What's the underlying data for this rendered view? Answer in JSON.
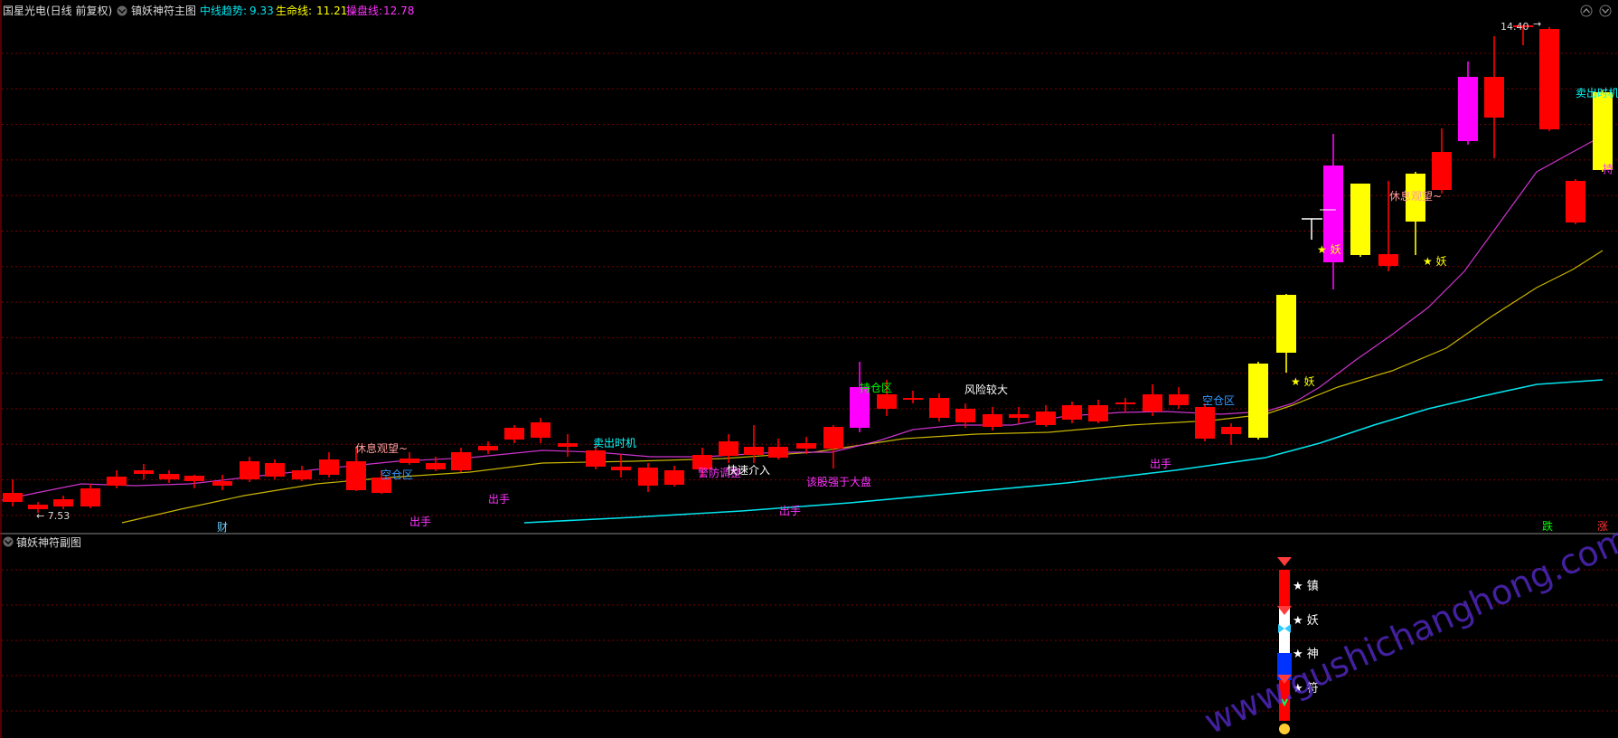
{
  "main_header": {
    "stock_name": "国星光电(日线 前复权)",
    "indicator_name": "镇妖神符主图",
    "midline_label": "中线趋势:",
    "midline_value": "9.33",
    "lifeline_label": "生命线:",
    "lifeline_value": "11.21",
    "operator_label": "操盘线:",
    "operator_value": "12.78"
  },
  "sub_header": {
    "indicator_name": "镇妖神符副图"
  },
  "price_marks": {
    "low_label": "← 7.53",
    "high_label": "14.40",
    "high_arrow": "→"
  },
  "annotations": [
    {
      "text": "休息观望~",
      "color": "#ff9b9b"
    },
    {
      "text": "空仓区",
      "color": "#3399ff"
    },
    {
      "text": "出手",
      "color": "#ff33ff"
    },
    {
      "text": "出手",
      "color": "#ff33ff"
    },
    {
      "text": "卖出时机",
      "color": "#00ffff"
    },
    {
      "text": "警防调整",
      "color": "#ff33ff"
    },
    {
      "text": "快速介入",
      "color": "#ffffff"
    },
    {
      "text": "该股强于大盘",
      "color": "#ff33ff"
    },
    {
      "text": "出手",
      "color": "#ff33ff"
    },
    {
      "text": "持仓区",
      "color": "#00ff00"
    },
    {
      "text": "风险较大",
      "color": "#ffffff"
    },
    {
      "text": "空仓区",
      "color": "#3399ff"
    },
    {
      "text": "出手",
      "color": "#ff33ff"
    },
    {
      "text": "★ 妖",
      "color": "#ffff00"
    },
    {
      "text": "★ 妖",
      "color": "#ffff00"
    },
    {
      "text": "★ 妖",
      "color": "#ffff00"
    },
    {
      "text": "休息观望~",
      "color": "#ff9b9b"
    },
    {
      "text": "卖出时机",
      "color": "#00ffff"
    },
    {
      "text": "持",
      "color": "#ff33ff"
    },
    {
      "text": "财",
      "color": "#66ccff"
    },
    {
      "text": "跌",
      "color": "#00ff00"
    },
    {
      "text": "涨",
      "color": "#ff3333"
    }
  ],
  "sub_labels": [
    "★ 镇",
    "★ 妖",
    "★ 神",
    "★ 符"
  ],
  "watermark": "www.gushichanghong.com",
  "colors": {
    "up": "#ff0000",
    "down": "#ff0000",
    "magenta": "#ff00ff",
    "yellow": "#ffff00",
    "cyan": "#00e5ee",
    "grid": "#7a0000",
    "operator": "#cc33cc",
    "lifeline": "#c8b400"
  },
  "chart_data": {
    "type": "candlestick",
    "title": "国星光电(日线 前复权)",
    "series": [
      {
        "name": "中线趋势",
        "last": 9.33
      },
      {
        "name": "生命线",
        "last": 11.21
      },
      {
        "name": "操盘线",
        "last": 12.78
      }
    ],
    "price_range": [
      7.53,
      14.4
    ],
    "grid": true
  }
}
